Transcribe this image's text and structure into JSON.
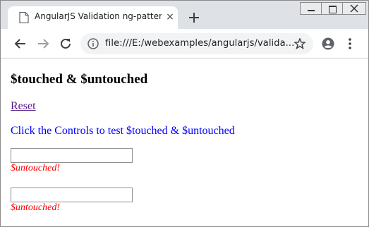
{
  "browser": {
    "tab_title": "AngularJS Validation ng-pattern",
    "tab_close": "×",
    "url": "file:///E:/webexamples/angularjs/valida...",
    "icons": {
      "tab_icon": "document-icon",
      "new_tab": "plus-icon",
      "back": "arrow-left-icon",
      "forward": "arrow-right-icon",
      "reload": "reload-icon",
      "info": "info-icon",
      "bookmark": "star-icon",
      "profile": "account-circle-icon",
      "menu": "kebab-menu-icon"
    }
  },
  "page": {
    "heading": "$touched & $untouched",
    "reset_link": "Reset",
    "instruction": "Click the Controls to test $touched & $untouched",
    "fields": [
      {
        "value": "",
        "status": "$untouched!"
      },
      {
        "value": "",
        "status": "$untouched!"
      }
    ],
    "colors": {
      "link": "#551a8b",
      "instruction": "#0000ff",
      "status": "#ff0000"
    }
  }
}
